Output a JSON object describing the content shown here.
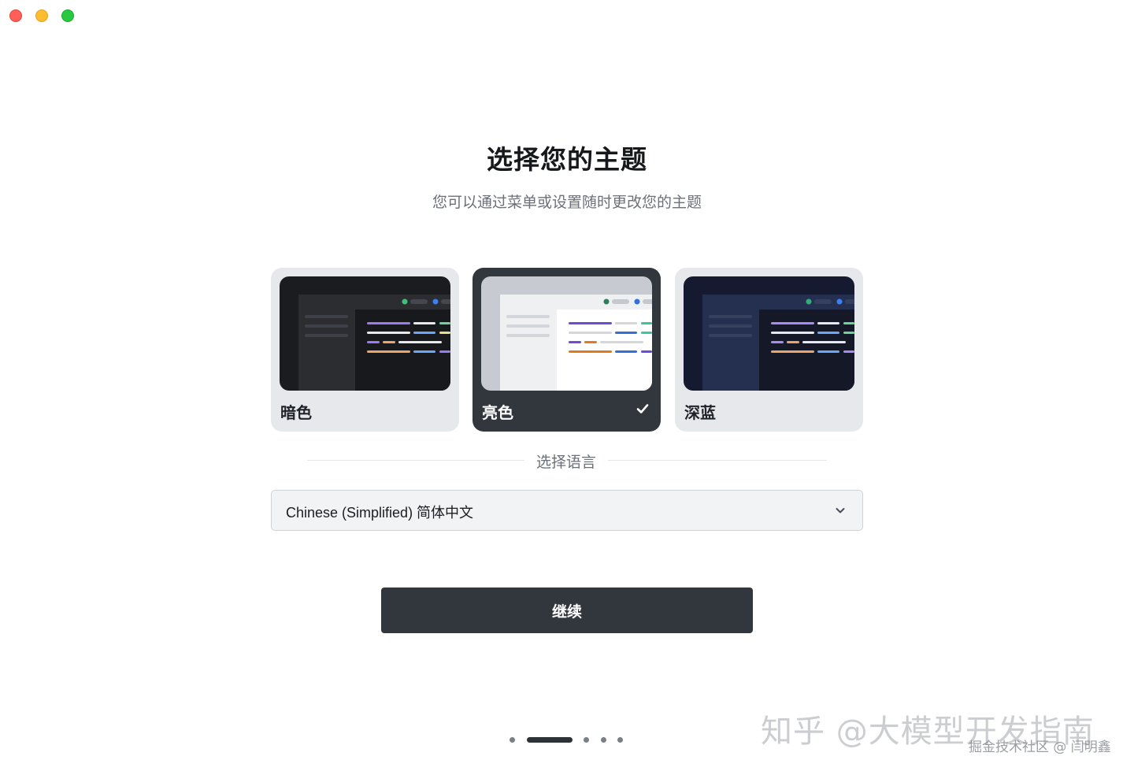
{
  "window": {
    "controls": [
      "close",
      "minimize",
      "zoom"
    ]
  },
  "header": {
    "title": "选择您的主题",
    "subtitle": "您可以通过菜单或设置随时更改您的主题"
  },
  "themes": [
    {
      "label": "暗色",
      "selected": false
    },
    {
      "label": "亮色",
      "selected": true
    },
    {
      "label": "深蓝",
      "selected": false
    }
  ],
  "language": {
    "section_label": "选择语言",
    "selected": "Chinese (Simplified) 简体中文"
  },
  "actions": {
    "continue_label": "继续"
  },
  "pager": {
    "total": 5,
    "current": 2
  },
  "watermark": {
    "main": "知乎 @大模型开发指南",
    "sub": "掘金技术社区 @ 闫明鑫"
  },
  "colors": {
    "accent_dark": "#32363d",
    "close": "#ff5f57",
    "minimize": "#febc2e",
    "zoom": "#28c840"
  }
}
